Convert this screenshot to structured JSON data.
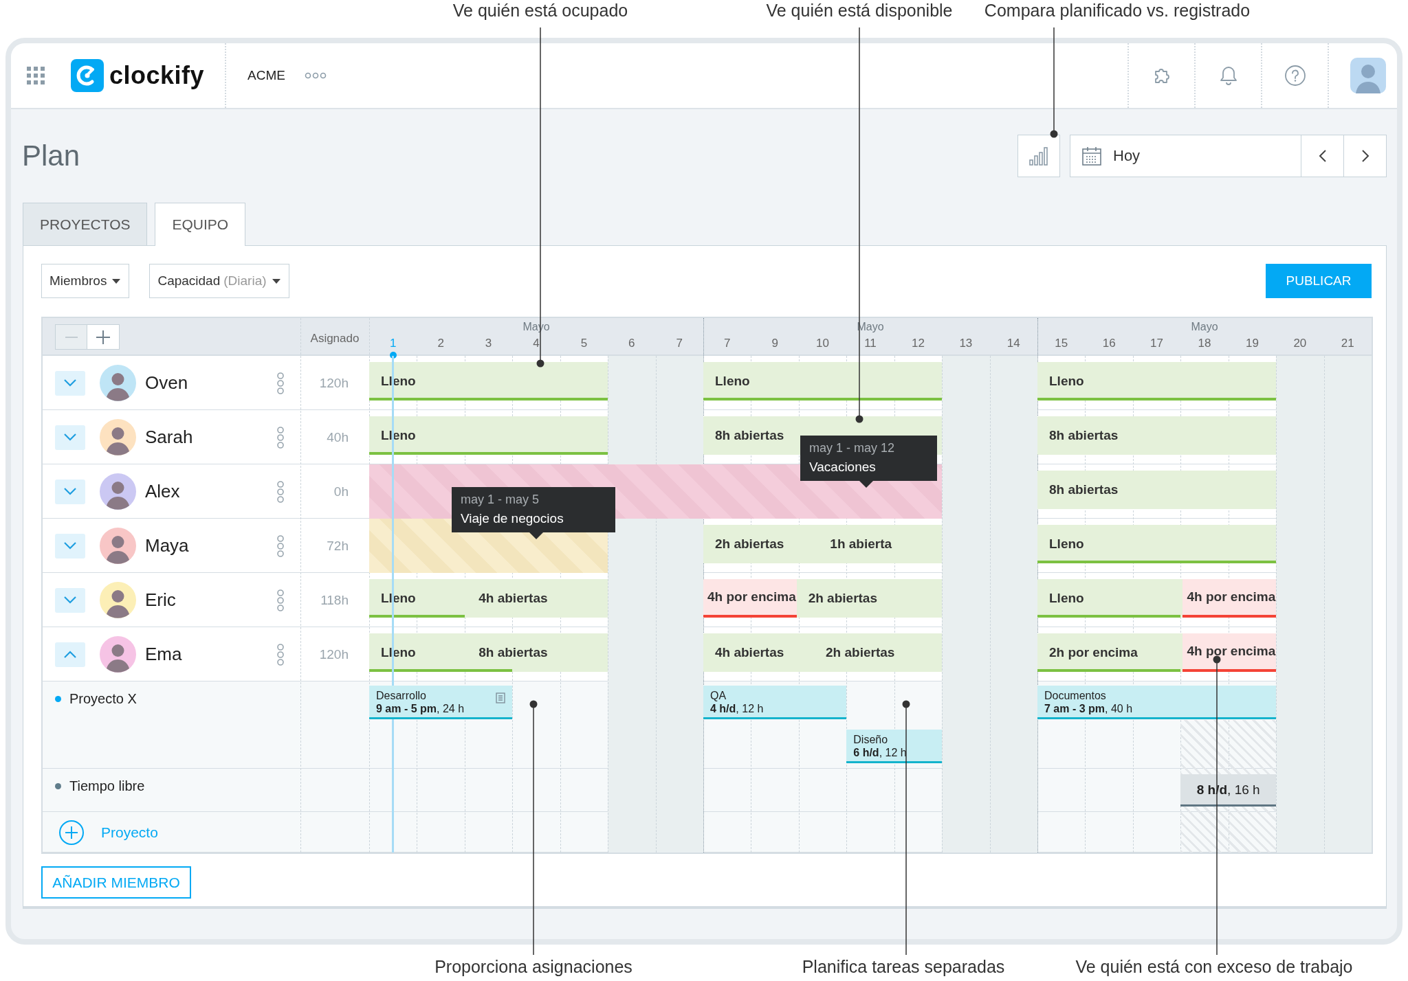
{
  "callouts": [
    {
      "text": "Ve quién está ocupado"
    },
    {
      "text": "Ve quién está disponible"
    },
    {
      "text": "Compara planificado vs. registrado"
    },
    {
      "text": "Proporciona asignaciones"
    },
    {
      "text": "Planifica tareas separadas"
    },
    {
      "text": "Ve quién está con exceso de trabajo"
    }
  ],
  "topbar": {
    "logo": "clockify",
    "workspace": "ACME"
  },
  "page": {
    "title": "Plan",
    "date_button": "Hoy"
  },
  "tabs": [
    {
      "label": "PROYECTOS",
      "selected": false
    },
    {
      "label": "EQUIPO",
      "selected": true
    }
  ],
  "filters": [
    {
      "label": "Miembros"
    },
    {
      "label": "Capacidad",
      "qualifier": "(Diaria)"
    }
  ],
  "publish_button": "PUBLICAR",
  "schedule": {
    "zoom_buttons": [
      {
        "kind": "out",
        "disabled": true
      },
      {
        "kind": "in",
        "disabled": false
      }
    ],
    "assigned_heading": "Asignado",
    "weeks": [
      {
        "month": "Mayo",
        "days": [
          {
            "label": "1",
            "today": true,
            "weekend": false
          },
          {
            "label": "2",
            "today": false,
            "weekend": false
          },
          {
            "label": "3",
            "today": false,
            "weekend": false
          },
          {
            "label": "4",
            "today": false,
            "weekend": false
          },
          {
            "label": "5",
            "today": false,
            "weekend": false
          },
          {
            "label": "6",
            "today": false,
            "weekend": true
          },
          {
            "label": "7",
            "today": false,
            "weekend": true
          }
        ]
      },
      {
        "month": "Mayo",
        "days": [
          {
            "label": "7",
            "today": false,
            "weekend": false
          },
          {
            "label": "9",
            "today": false,
            "weekend": false
          },
          {
            "label": "10",
            "today": false,
            "weekend": false
          },
          {
            "label": "11",
            "today": false,
            "weekend": false
          },
          {
            "label": "12",
            "today": false,
            "weekend": false
          },
          {
            "label": "13",
            "today": false,
            "weekend": true
          },
          {
            "label": "14",
            "today": false,
            "weekend": true
          }
        ]
      },
      {
        "month": "Mayo",
        "days": [
          {
            "label": "15",
            "today": false,
            "weekend": false
          },
          {
            "label": "16",
            "today": false,
            "weekend": false
          },
          {
            "label": "17",
            "today": false,
            "weekend": false
          },
          {
            "label": "18",
            "today": false,
            "weekend": false
          },
          {
            "label": "19",
            "today": false,
            "weekend": false
          },
          {
            "label": "20",
            "today": false,
            "weekend": true
          },
          {
            "label": "21",
            "today": false,
            "weekend": true
          }
        ]
      }
    ],
    "members": [
      {
        "name": "Oven",
        "assigned": "120h",
        "expanded": false,
        "blocks": [
          {
            "kind": "capacity",
            "level": 1,
            "segments": [
              {
                "label": "Lleno",
                "kind": "normal"
              }
            ]
          },
          {
            "kind": "capacity",
            "level": 1,
            "segments": [
              {
                "label": "Lleno",
                "kind": "normal"
              }
            ]
          },
          {
            "kind": "capacity",
            "level": 1,
            "segments": [
              {
                "label": "Lleno",
                "kind": "normal"
              }
            ]
          }
        ]
      },
      {
        "name": "Sarah",
        "assigned": "40h",
        "expanded": false,
        "blocks": [
          {
            "kind": "capacity",
            "level": 1,
            "segments": [
              {
                "label": "Lleno",
                "kind": "normal"
              }
            ]
          },
          {
            "kind": "capacity",
            "level": 0,
            "segments": [
              {
                "label": "8h abiertas",
                "kind": "normal"
              }
            ]
          },
          {
            "kind": "capacity",
            "level": 0,
            "segments": [
              {
                "label": "8h abiertas",
                "kind": "normal"
              }
            ]
          }
        ]
      },
      {
        "name": "Alex",
        "assigned": "0h",
        "expanded": false,
        "blocks": [
          {
            "kind": "vacation",
            "dates": "may 1 - may 12",
            "reason": "Vacaciones"
          },
          {
            "kind": "capacity",
            "level": 0,
            "segments": [
              {
                "label": "8h abiertas",
                "kind": "normal"
              }
            ]
          }
        ]
      },
      {
        "name": "Maya",
        "assigned": "72h",
        "expanded": false,
        "blocks": [
          {
            "kind": "trip",
            "dates": "may 1 - may 5",
            "reason": "Viaje de negocios"
          },
          {
            "kind": "capacity",
            "level": 0,
            "segments": [
              {
                "label": "2h abiertas",
                "kind": "normal"
              },
              {
                "label": "1h abierta",
                "kind": "normal"
              }
            ]
          },
          {
            "kind": "capacity",
            "level": 1,
            "segments": [
              {
                "label": "Lleno",
                "kind": "normal"
              }
            ]
          }
        ]
      },
      {
        "name": "Eric",
        "assigned": "118h",
        "expanded": false,
        "blocks": [
          {
            "kind": "capacity",
            "level": 0.4,
            "segments": [
              {
                "label": "Lleno",
                "kind": "normal"
              },
              {
                "label": "4h abiertas",
                "kind": "normal"
              }
            ]
          },
          {
            "kind": "capacity",
            "level": 0,
            "segments": [
              {
                "label": "4h por encima",
                "kind": "over"
              },
              {
                "label": "2h abiertas",
                "kind": "normal"
              }
            ]
          },
          {
            "kind": "capacity",
            "level": 0.6,
            "segments": [
              {
                "label": "Lleno",
                "kind": "normal"
              },
              {
                "label": "4h por encima",
                "kind": "over"
              }
            ]
          }
        ]
      },
      {
        "name": "Ema",
        "assigned": "120h",
        "expanded": true,
        "blocks": [
          {
            "kind": "capacity",
            "level": 0.6,
            "segments": [
              {
                "label": "Lleno",
                "kind": "normal"
              },
              {
                "label": "8h abiertas",
                "kind": "normal"
              }
            ]
          },
          {
            "kind": "capacity",
            "level": 0,
            "segments": [
              {
                "label": "4h abiertas",
                "kind": "normal"
              },
              {
                "label": "2h abiertas",
                "kind": "normal"
              }
            ]
          },
          {
            "kind": "capacity",
            "level": 0.6,
            "segments": [
              {
                "label": "2h por encima",
                "kind": "normal"
              },
              {
                "label": "4h por encima",
                "kind": "over"
              }
            ]
          }
        ]
      }
    ],
    "rows": [
      {
        "kind": "project",
        "name": "Proyecto X",
        "color": "#03a9f4",
        "lanes": [
          [
            {
              "title": "Desarrollo",
              "detail": "**9 am - 5 pm**, 24 h",
              "note": true
            },
            {
              "title": "QA",
              "detail": "**4 h/d**, 12 h",
              "note": false
            },
            {
              "title": "Documentos",
              "detail": "**7 am - 3 pm**, 40 h",
              "note": false
            }
          ],
          [
            {
              "title": "Diseño",
              "detail": "**6 h/d**, 12 h",
              "note": false
            }
          ]
        ]
      },
      {
        "kind": "time_off",
        "name": "Tiempo libre",
        "color": "#607d8b",
        "lanes": [
          [
            {
              "detail": "**8 h/d**, 16 h"
            }
          ]
        ]
      }
    ],
    "add_project": "Proyecto"
  },
  "add_member_button": "AÑADIR MIEMBRO"
}
